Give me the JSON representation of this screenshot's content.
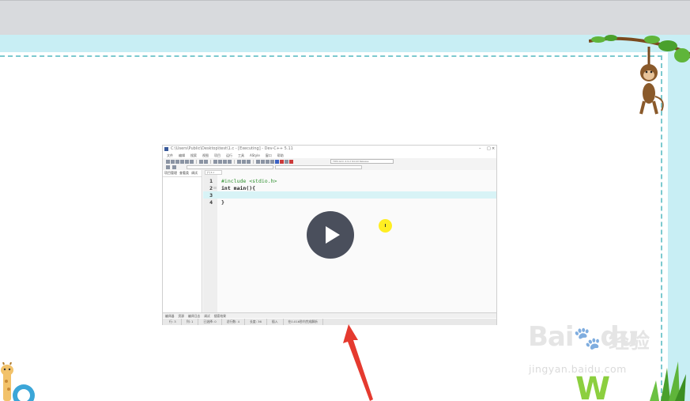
{
  "ide": {
    "title": "C:\\Users\\Public\\Desktop\\test\\1.c - [Executing] - Dev-C++ 5.11",
    "window_controls": [
      "–",
      "□",
      "×"
    ],
    "menu": [
      "文件",
      "编辑",
      "搜索",
      "视图",
      "项目",
      "运行",
      "工具",
      "AStyle",
      "窗口",
      "帮助"
    ],
    "compiler_combo": "TDM-GCC 4.9.2 64-bit Release",
    "sidebar_tabs": [
      "项目管理",
      "查看类",
      "调试"
    ],
    "file_tab": "[*] 1.c",
    "code_lines": [
      {
        "num": "1",
        "text": "#include <stdio.h>",
        "kind": "preprocessor"
      },
      {
        "num": "2",
        "text": "int main(){",
        "kind": "keyword",
        "fold": "⊟"
      },
      {
        "num": "3",
        "text": "",
        "kind": "plain",
        "current": true
      },
      {
        "num": "4",
        "text": "}",
        "kind": "plain"
      }
    ],
    "bottom_tabs": [
      "编译器",
      "资源",
      "编译日志",
      "调试",
      "搜索结果"
    ],
    "status": [
      "行: 3",
      "列: 1",
      "已选择: 0",
      "总行数: 4",
      "长度: 36",
      "插入",
      "在0.016秒内完成解析"
    ]
  },
  "video": {
    "play_icon": "play-icon"
  },
  "watermark": {
    "logo": "Bai",
    "logo_suffix": "du",
    "brand_cn": "经验",
    "url": "jingyan.baidu.com"
  },
  "colors": {
    "frame": "#c8eef4",
    "dash": "#7cc9cf",
    "play": "#4a4f5c",
    "arrow": "#e53a2f",
    "cursor": "#ffee22"
  }
}
